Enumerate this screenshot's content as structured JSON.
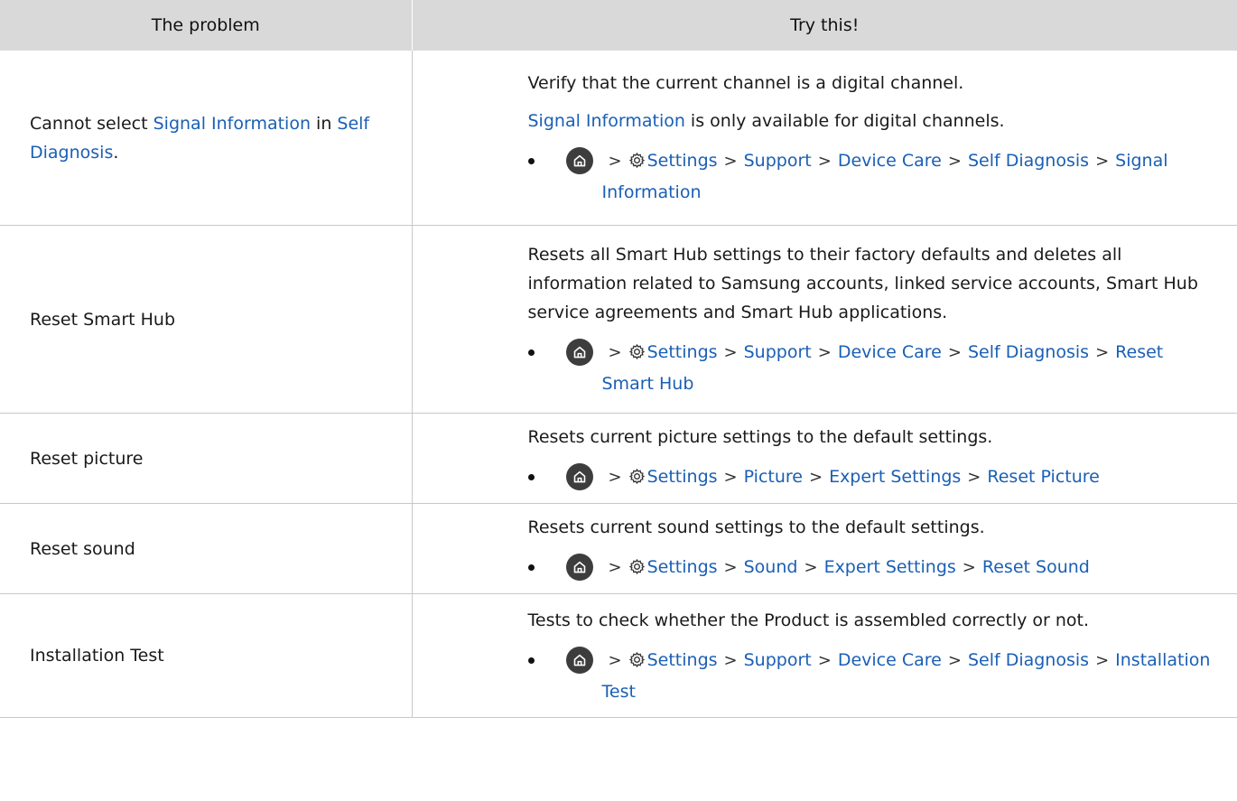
{
  "header": {
    "problem": "The problem",
    "solution": "Try this!"
  },
  "separator": ">",
  "icons": {
    "home": "home-icon",
    "settings": "gear-icon",
    "separator": "chevron-right-icon"
  },
  "colors": {
    "link": "#1a5fb4",
    "header_bg": "#d9d9d9",
    "home_bg": "#3d3d3d"
  },
  "rows": [
    {
      "problem_parts": [
        "Cannot select ",
        "Signal Information",
        " in ",
        "Self Diagnosis",
        "."
      ],
      "paragraphs": [
        "Verify that the current channel is a digital channel."
      ],
      "p2_link": "Signal Information",
      "p2_text": " is only available for digital channels.",
      "path": [
        "Settings",
        "Support",
        "Device Care",
        "Self Diagnosis",
        "Signal Information"
      ]
    },
    {
      "problem": "Reset Smart Hub",
      "paragraphs": [
        "Resets all Smart Hub settings to their factory defaults and deletes all information related to Samsung accounts, linked service accounts, Smart Hub service agreements and Smart Hub applications."
      ],
      "path": [
        "Settings",
        "Support",
        "Device Care",
        "Self Diagnosis",
        "Reset Smart Hub"
      ]
    },
    {
      "problem": "Reset picture",
      "paragraphs": [
        "Resets current picture settings to the default settings."
      ],
      "path": [
        "Settings",
        "Picture",
        "Expert Settings",
        "Reset Picture"
      ]
    },
    {
      "problem": "Reset sound",
      "paragraphs": [
        "Resets current sound settings to the default settings."
      ],
      "path": [
        "Settings",
        "Sound",
        "Expert Settings",
        "Reset Sound"
      ]
    },
    {
      "problem": "Installation Test",
      "paragraphs": [
        "Tests to check whether the Product is assembled correctly or not."
      ],
      "path": [
        "Settings",
        "Support",
        "Device Care",
        "Self Diagnosis",
        "Installation Test"
      ]
    }
  ]
}
